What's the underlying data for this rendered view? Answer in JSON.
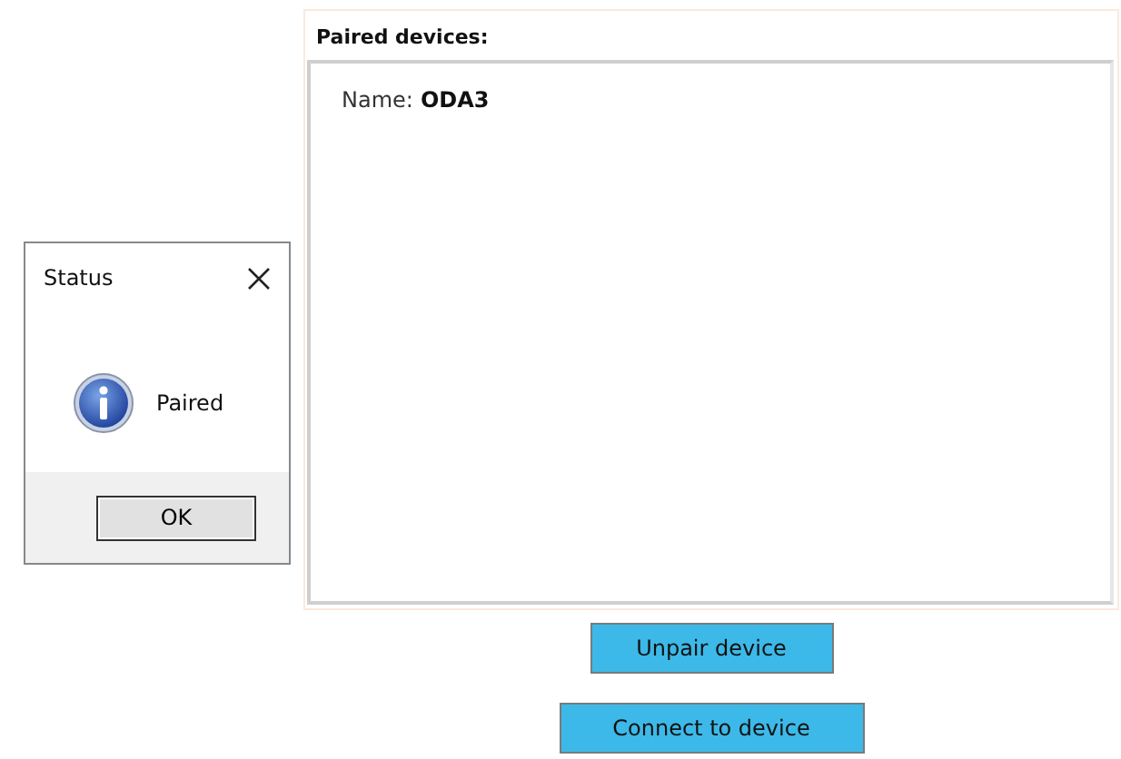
{
  "dialog": {
    "title": "Status",
    "message": "Paired",
    "button": "OK"
  },
  "panel": {
    "title": "Paired devices:",
    "devices": [
      {
        "label": "Name:",
        "name": "ODA3"
      }
    ]
  },
  "buttons": [
    {
      "label": "Unpair device"
    },
    {
      "label": "Connect to device"
    }
  ]
}
